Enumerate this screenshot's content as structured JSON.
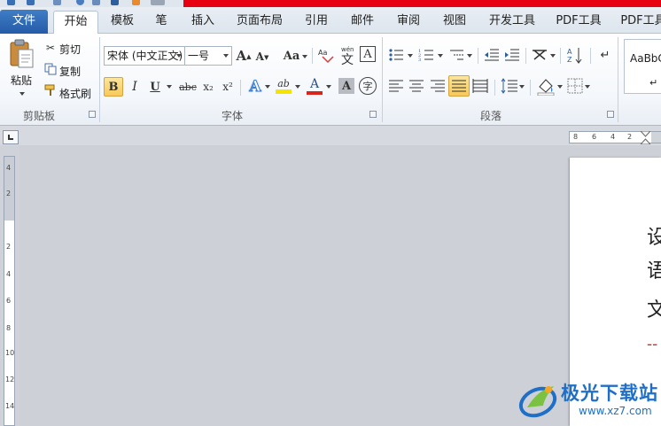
{
  "tabs": [
    "文件",
    "开始",
    "模板",
    "笔",
    "插入",
    "页面布局",
    "引用",
    "邮件",
    "审阅",
    "视图",
    "开发工具",
    "PDF工具",
    "PDF工具"
  ],
  "active_tab_index": 1,
  "clipboard": {
    "paste": "粘贴",
    "cut": "剪切",
    "copy": "复制",
    "format_painter": "格式刷",
    "group": "剪贴板"
  },
  "font": {
    "family": "宋体 (中文正文)",
    "size": "一号",
    "group": "字体",
    "grow_glyph": "A",
    "shrink_glyph": "A",
    "case_glyph": "Aa",
    "bold": "B",
    "italic": "I",
    "underline": "U",
    "strikethrough": "abc",
    "subscript": "x₂",
    "superscript": "x²",
    "text_effect": "A",
    "highlight": "ab",
    "font_color": "A",
    "char_shading": "A",
    "enclose": "字",
    "pinyin": "文",
    "border": "A"
  },
  "paragraph": {
    "group": "段落"
  },
  "styles": {
    "preview": "AaBbC",
    "name": "↵ 正"
  },
  "document": {
    "line1": "设",
    "line2": "语",
    "line3": "文",
    "line4": "--"
  },
  "ruler": {
    "h_numbers": [
      "8",
      "6",
      "4",
      "2"
    ],
    "v_numbers": [
      "4",
      "2",
      "2",
      "4",
      "6",
      "8",
      "10",
      "12",
      "14"
    ]
  },
  "watermark": {
    "brand": "极光下载站",
    "url": "www.xz7.com"
  },
  "colors": {
    "accent": "#2459a6",
    "title_red": "#e60012",
    "highlight_yellow": "#f7c95a",
    "font_color_red": "#d9261c",
    "watermark_blue": "#1f6fc7"
  }
}
